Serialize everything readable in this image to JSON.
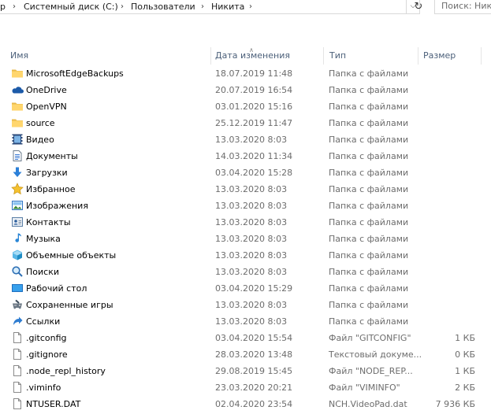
{
  "address_bar": {
    "lead": "р",
    "crumbs": [
      "Системный диск (C:)",
      "Пользователи",
      "Никита"
    ],
    "search_placeholder": "Поиск: Ник"
  },
  "columns": {
    "name": "Имя",
    "date": "Дата изменения",
    "type": "Тип",
    "size": "Размер"
  },
  "files": [
    {
      "icon": "folder-icon",
      "name": "MicrosoftEdgeBackups",
      "date": "18.07.2019 11:48",
      "type": "Папка с файлами",
      "size": ""
    },
    {
      "icon": "onedrive-icon",
      "name": "OneDrive",
      "date": "20.07.2019 16:54",
      "type": "Папка с файлами",
      "size": ""
    },
    {
      "icon": "folder-icon",
      "name": "OpenVPN",
      "date": "03.01.2020 15:16",
      "type": "Папка с файлами",
      "size": ""
    },
    {
      "icon": "folder-icon",
      "name": "source",
      "date": "25.12.2019 11:47",
      "type": "Папка с файлами",
      "size": ""
    },
    {
      "icon": "video-folder-icon",
      "name": "Видео",
      "date": "13.03.2020 8:03",
      "type": "Папка с файлами",
      "size": ""
    },
    {
      "icon": "documents-folder-icon",
      "name": "Документы",
      "date": "14.03.2020 11:34",
      "type": "Папка с файлами",
      "size": ""
    },
    {
      "icon": "downloads-folder-icon",
      "name": "Загрузки",
      "date": "03.04.2020 15:28",
      "type": "Папка с файлами",
      "size": ""
    },
    {
      "icon": "favorites-star-icon",
      "name": "Избранное",
      "date": "13.03.2020 8:03",
      "type": "Папка с файлами",
      "size": ""
    },
    {
      "icon": "pictures-folder-icon",
      "name": "Изображения",
      "date": "13.03.2020 8:03",
      "type": "Папка с файлами",
      "size": ""
    },
    {
      "icon": "contacts-folder-icon",
      "name": "Контакты",
      "date": "13.03.2020 8:03",
      "type": "Папка с файлами",
      "size": ""
    },
    {
      "icon": "music-note-icon",
      "name": "Музыка",
      "date": "13.03.2020 8:03",
      "type": "Папка с файлами",
      "size": ""
    },
    {
      "icon": "3d-objects-icon",
      "name": "Объемные объекты",
      "date": "13.03.2020 8:03",
      "type": "Папка с файлами",
      "size": ""
    },
    {
      "icon": "search-folder-icon",
      "name": "Поиски",
      "date": "13.03.2020 8:03",
      "type": "Папка с файлами",
      "size": ""
    },
    {
      "icon": "desktop-folder-icon",
      "name": "Рабочий стол",
      "date": "03.04.2020 15:29",
      "type": "Папка с файлами",
      "size": ""
    },
    {
      "icon": "saved-games-icon",
      "name": "Сохраненные игры",
      "date": "13.03.2020 8:03",
      "type": "Папка с файлами",
      "size": ""
    },
    {
      "icon": "links-folder-icon",
      "name": "Ссылки",
      "date": "13.03.2020 8:03",
      "type": "Папка с файлами",
      "size": ""
    },
    {
      "icon": "file-icon",
      "name": ".gitconfig",
      "date": "03.04.2020 15:54",
      "type": "Файл \"GITCONFIG\"",
      "size": "1 КБ"
    },
    {
      "icon": "file-icon",
      "name": ".gitignore",
      "date": "28.03.2020 13:48",
      "type": "Текстовый докуме...",
      "size": "0 КБ"
    },
    {
      "icon": "file-icon",
      "name": ".node_repl_history",
      "date": "29.08.2019 15:45",
      "type": "Файл \"NODE_REP...",
      "size": "1 КБ"
    },
    {
      "icon": "file-icon",
      "name": ".viminfo",
      "date": "23.03.2020 20:21",
      "type": "Файл \"VIMINFO\"",
      "size": "2 КБ"
    },
    {
      "icon": "file-icon",
      "name": "NTUSER.DAT",
      "date": "02.04.2020 23:54",
      "type": "NCH.VideoPad.dat",
      "size": "7 936 КБ"
    }
  ]
}
